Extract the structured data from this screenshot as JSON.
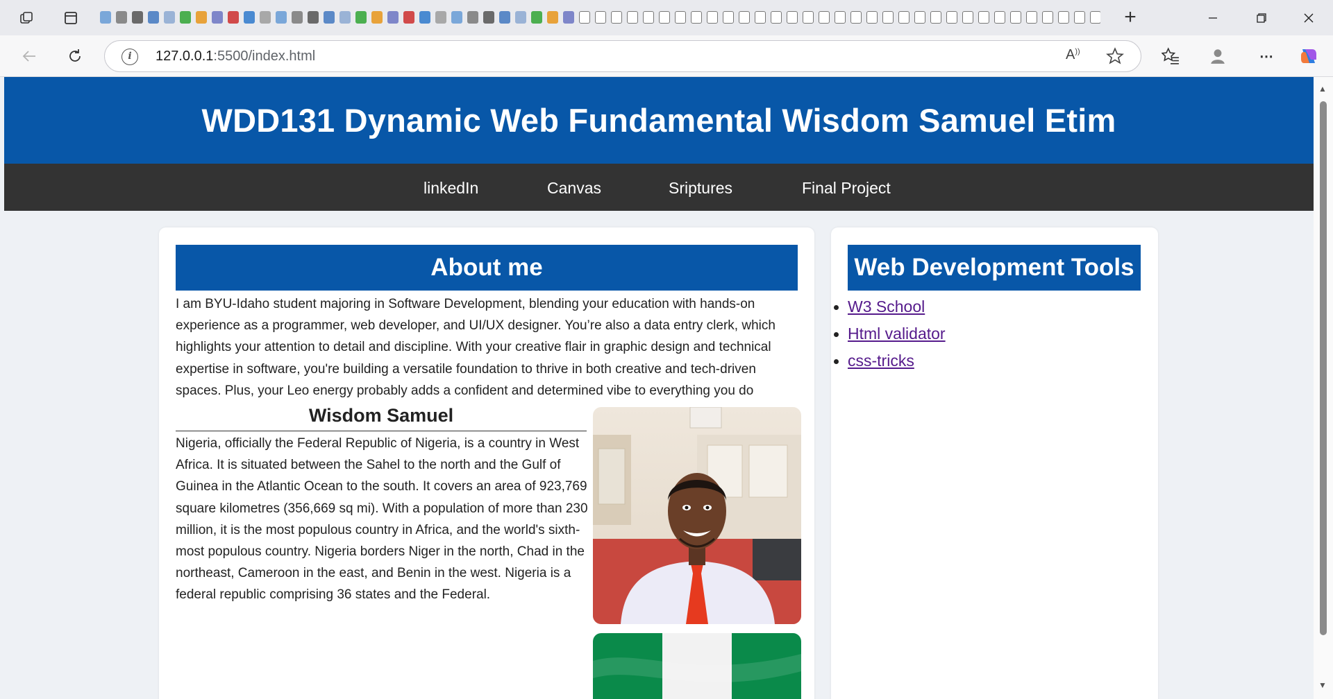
{
  "browser": {
    "tab_count": 65,
    "new_tab_label": "+",
    "url_host": "127.0.0.1",
    "url_path": ":5500/index.html"
  },
  "site": {
    "title": "WDD131 Dynamic Web Fundamental Wisdom Samuel Etim",
    "nav": [
      "linkedIn",
      "Canvas",
      "Sriptures",
      "Final Project"
    ]
  },
  "about": {
    "heading": "About me",
    "text": "I am BYU-Idaho student majoring in Software Development, blending your education with hands-on experience as a programmer, web developer, and UI/UX designer. You’re also a data entry clerk, which highlights your attention to detail and discipline. With your creative flair in graphic design and technical expertise in software, you're building a versatile foundation to thrive in both creative and tech-driven spaces. Plus, your Leo energy probably adds a confident and determined vibe to everything you do",
    "subheading": "Wisdom Samuel",
    "nigeria_text": "Nigeria, officially the Federal Republic of Nigeria, is a country in West Africa. It is situated between the Sahel to the north and the Gulf of Guinea in the Atlantic Ocean to the south. It covers an area of 923,769 square kilometres (356,669 sq mi). With a population of more than 230 million, it is the most populous country in Africa, and the world's sixth-most populous country. Nigeria borders Niger in the north, Chad in the northeast, Cameroon in the east, and Benin in the west. Nigeria is a federal republic comprising 36 states and the Federal."
  },
  "tools": {
    "heading": "Web Development Tools",
    "links": [
      "W3 School",
      "Html validator",
      "css-tricks"
    ]
  },
  "colors": {
    "brand_blue": "#0857a8",
    "nav_dark": "#333333",
    "visited_link": "#551a8b",
    "flag_green": "#008751"
  }
}
